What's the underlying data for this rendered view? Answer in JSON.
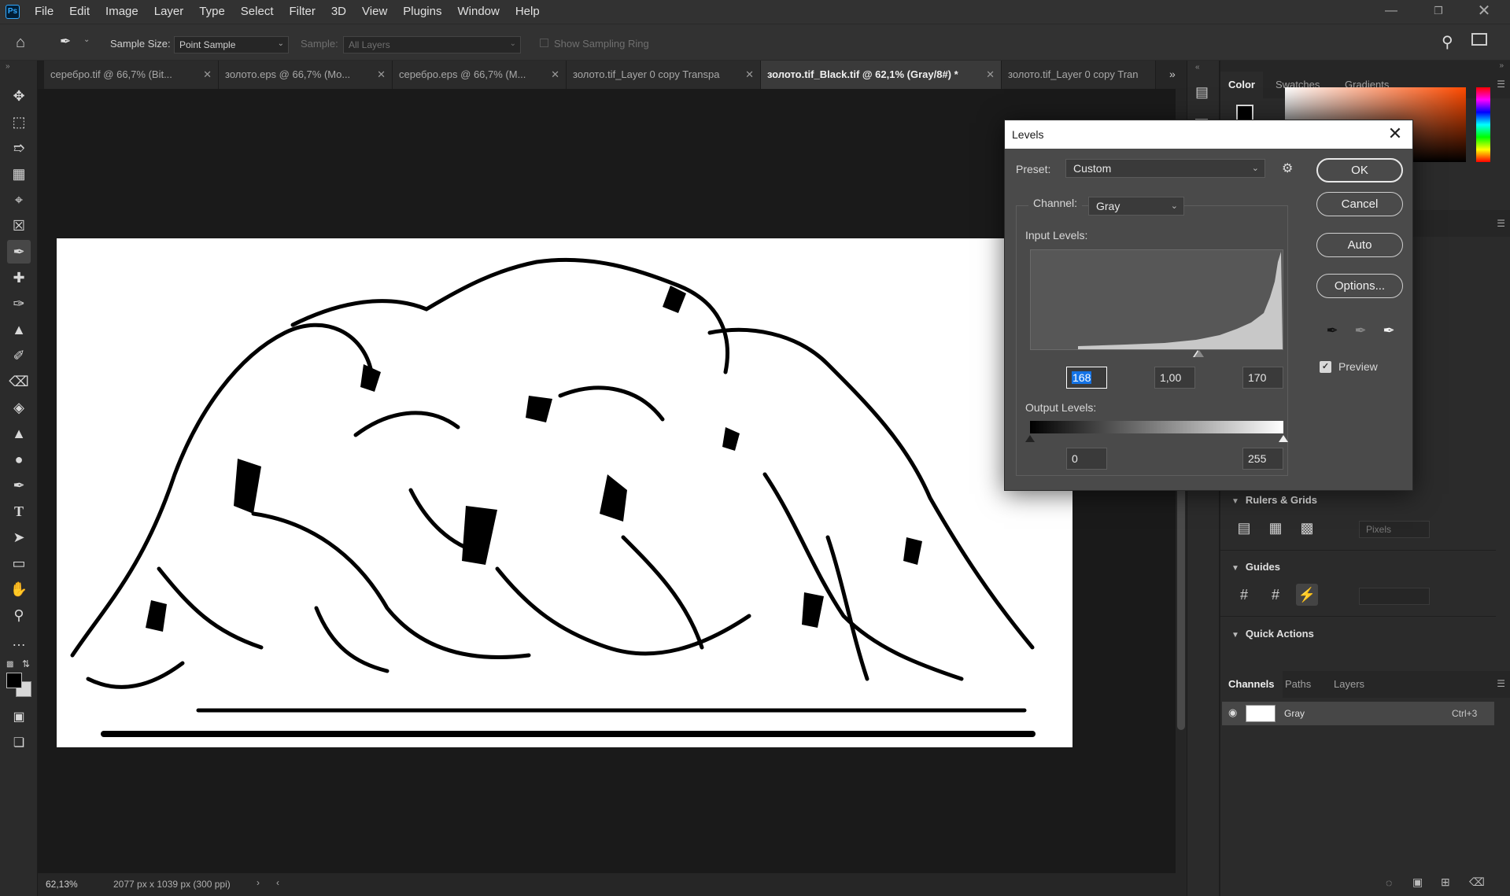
{
  "app": {
    "logo": "Ps"
  },
  "menu": [
    "File",
    "Edit",
    "Image",
    "Layer",
    "Type",
    "Select",
    "Filter",
    "3D",
    "View",
    "Plugins",
    "Window",
    "Help"
  ],
  "options": {
    "sample_size_label": "Sample Size:",
    "sample_size_value": "Point Sample",
    "sample_label": "Sample:",
    "sample_value": "All Layers",
    "sampling_ring_label": "Show Sampling Ring"
  },
  "tabs": [
    {
      "label": "серебро.tif @ 66,7% (Bit...",
      "active": false
    },
    {
      "label": "золото.eps @ 66,7% (Mo...",
      "active": false
    },
    {
      "label": "серебро.eps @ 66,7% (M...",
      "active": false
    },
    {
      "label": "золото.tif_Layer 0 copy Transpa",
      "active": false
    },
    {
      "label": "золото.tif_Black.tif @ 62,1% (Gray/8#) *",
      "active": true
    },
    {
      "label": "золото.tif_Layer 0 copy Tran",
      "active": false
    }
  ],
  "status": {
    "zoom": "62,13%",
    "doc_info": "2077 px x 1039 px (300 ppi)"
  },
  "right_panel": {
    "color_tabs": [
      "Color",
      "Swatches",
      "Gradients"
    ],
    "rulers_grids": "Rulers & Grids",
    "units_value": "Pixels",
    "guides": "Guides",
    "quick_actions": "Quick Actions",
    "bottom_tabs": [
      "Channels",
      "Paths",
      "Layers"
    ],
    "channel_name": "Gray",
    "channel_shortcut": "Ctrl+3"
  },
  "levels": {
    "title": "Levels",
    "preset_label": "Preset:",
    "preset_value": "Custom",
    "channel_label": "Channel:",
    "channel_value": "Gray",
    "input_levels_label": "Input Levels:",
    "input_black": "168",
    "input_gamma": "1,00",
    "input_white": "170",
    "output_levels_label": "Output Levels:",
    "output_black": "0",
    "output_white": "255",
    "ok": "OK",
    "cancel": "Cancel",
    "auto": "Auto",
    "options": "Options...",
    "preview_label": "Preview",
    "preview_checked": true
  }
}
